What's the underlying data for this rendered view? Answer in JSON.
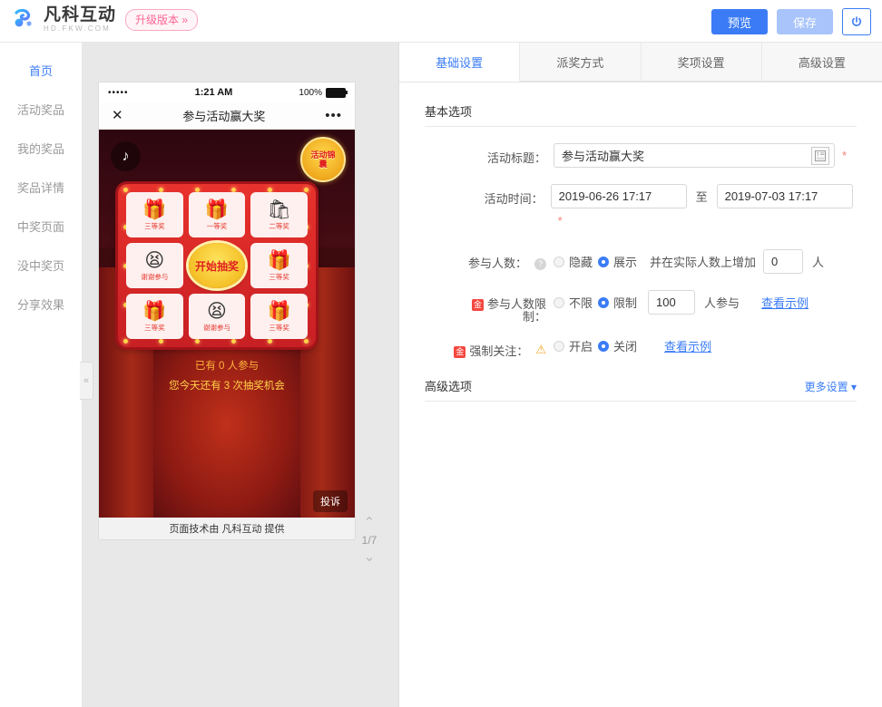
{
  "topbar": {
    "brand_cn": "凡科互动",
    "brand_en": "HD.FKW.COM",
    "upgrade_label": "升级版本 »",
    "preview_label": "预览",
    "save_label": "保存",
    "power_icon": "power-icon",
    "accent": "#3b7cf6"
  },
  "sidebar": {
    "collapse_icon": "«",
    "items": [
      {
        "label": "首页",
        "active": true
      },
      {
        "label": "活动奖品",
        "active": false
      },
      {
        "label": "我的奖品",
        "active": false
      },
      {
        "label": "奖品详情",
        "active": false
      },
      {
        "label": "中奖页面",
        "active": false
      },
      {
        "label": "没中奖页",
        "active": false
      },
      {
        "label": "分享效果",
        "active": false
      }
    ]
  },
  "preview": {
    "status": {
      "signal": "•••••",
      "time": "1:21 AM",
      "battery": "100%"
    },
    "nav": {
      "close_icon": "✕",
      "title": "参与活动赢大奖",
      "more_icon": "•••"
    },
    "music_icon": "♪",
    "gift_badge": "活动锦囊",
    "start_label": "开始抽奖",
    "cells": [
      {
        "icon": "🎁",
        "label": "三等奖"
      },
      {
        "icon": "🎁",
        "label": "一等奖"
      },
      {
        "icon": "🛍",
        "label": "二等奖"
      },
      {
        "icon": "😫",
        "label": "谢谢参与"
      },
      {
        "icon": "",
        "label": "开始抽奖"
      },
      {
        "icon": "🎁",
        "label": "三等奖"
      },
      {
        "icon": "🎁",
        "label": "三等奖"
      },
      {
        "icon": "😫",
        "label": "谢谢参与"
      },
      {
        "icon": "🎁",
        "label": "三等奖"
      }
    ],
    "joined_text": "已有 0 人参与",
    "chances_text": "您今天还有 3 次抽奖机会",
    "complain_label": "投诉",
    "footer_text": "页面技术由 凡科互动 提供",
    "pager": {
      "up": "⌃",
      "count": "1/7",
      "down": "⌄"
    }
  },
  "tabs": [
    {
      "label": "基础设置",
      "active": true
    },
    {
      "label": "派奖方式",
      "active": false
    },
    {
      "label": "奖项设置",
      "active": false
    },
    {
      "label": "高级设置",
      "active": false
    }
  ],
  "basic": {
    "section_title": "基本选项",
    "title_label": "活动标题：",
    "title_value": "参与活动赢大奖",
    "title_icon": "text-edit-icon",
    "time_label": "活动时间：",
    "time_start": "2019-06-26 17:17",
    "time_sep": "至",
    "time_end": "2019-07-03 17:17",
    "count_label": "参与人数：",
    "count_help": "?",
    "count_opt_hide": "隐藏",
    "count_opt_show": "展示",
    "count_selected": "展示",
    "count_mid_text": "并在实际人数上增加",
    "count_add_value": "0",
    "count_unit": "人",
    "limit_label_line1": "参与人数限",
    "limit_label_line2": "制：",
    "limit_opt_unlimited": "不限",
    "limit_opt_limited": "限制",
    "limit_selected": "限制",
    "limit_value": "100",
    "limit_unit": "人参与",
    "limit_example": "查看示例",
    "follow_label": "强制关注：",
    "follow_warn": "⚠",
    "follow_opt_on": "开启",
    "follow_opt_off": "关闭",
    "follow_selected": "关闭",
    "follow_example": "查看示例",
    "required_star": "*"
  },
  "advanced": {
    "section_title": "高级选项",
    "more_label": "更多设置 ▾"
  }
}
